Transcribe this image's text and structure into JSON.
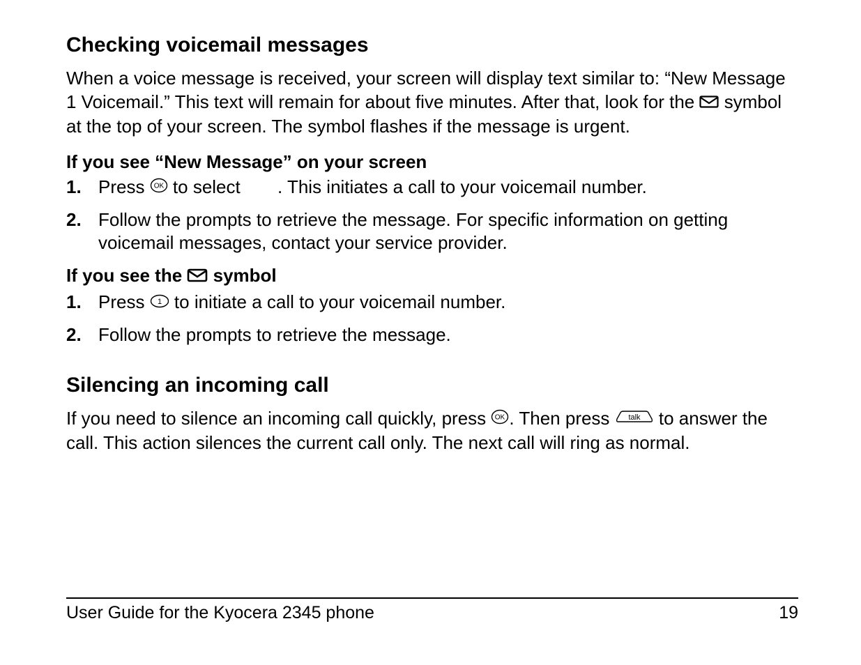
{
  "section1": {
    "heading": "Checking voicemail messages",
    "intro_a": "When a voice message is received, your screen will display text similar to: “New Message 1 Voicemail.” This text will remain for about five minutes. After that, look for the ",
    "intro_b": " symbol at the top of your screen. The symbol flashes if the message is urgent.",
    "sub1_heading": "If you see “New Message” on your screen",
    "sub1_step1_a": "Press ",
    "sub1_step1_b": " to select ",
    "sub1_step1_c": ". This initiates a call to your voicemail number.",
    "sub1_step2": "Follow the prompts to retrieve the message. For specific information on getting voicemail messages, contact your service provider.",
    "sub2_heading_a": "If you see the ",
    "sub2_heading_b": " symbol",
    "sub2_step1_a": "Press ",
    "sub2_step1_b": " to initiate a call to your voicemail number.",
    "sub2_step2": "Follow the prompts to retrieve the message."
  },
  "section2": {
    "heading": "Silencing an incoming call",
    "body_a": "If you need to silence an incoming call quickly, press ",
    "body_b": ". Then press ",
    "body_c": " to answer the call. This action silences the current call only. The next call will ring as normal."
  },
  "footer": {
    "title": "User Guide for the Kyocera 2345 phone",
    "page": "19"
  }
}
